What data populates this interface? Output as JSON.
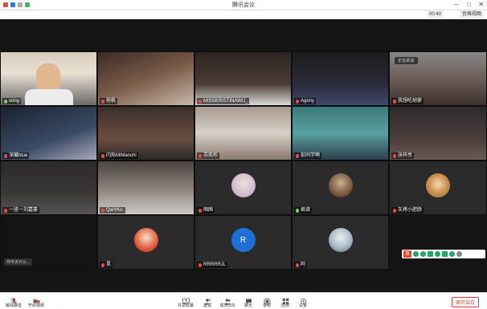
{
  "window": {
    "title": "腾讯会议"
  },
  "meeting": {
    "timer": "00:40",
    "view_mode": "宫格视图"
  },
  "participants": [
    {
      "name": "song",
      "mic": "on"
    },
    {
      "name": "杨帆",
      "mic": "off"
    },
    {
      "name": "MISSKRISTINAWU_",
      "mic": "off"
    },
    {
      "name": "Agony",
      "mic": "off"
    },
    {
      "name": "我想吃胡萝",
      "mic": "off"
    },
    {
      "name": "深藏blue",
      "mic": "off"
    },
    {
      "name": "闪烁MiManchi",
      "mic": "off"
    },
    {
      "name": "苏奕彤",
      "mic": "off"
    },
    {
      "name": "彭同学啊",
      "mic": "off"
    },
    {
      "name": "张梓亮",
      "mic": "off"
    },
    {
      "name": "一班一刘嘉豪",
      "mic": "off"
    },
    {
      "name": "QwYKo.",
      "mic": "off"
    },
    {
      "name": "囤囤",
      "mic": "off"
    },
    {
      "name": "君淑",
      "mic": "on"
    },
    {
      "name": "灰烤小肥肠",
      "mic": "off"
    },
    {
      "name": "昊",
      "mic": "off"
    },
    {
      "name": "RRRRRJL",
      "mic": "off",
      "avatar_letter": "R"
    },
    {
      "name": "阿",
      "mic": "off"
    }
  ],
  "chat_toast": "正在讲话:",
  "self_toast": "你今天什么...",
  "toolbar": {
    "unmute": "解除静音",
    "video": "开启视频",
    "share": "共享屏幕",
    "invite": "邀请",
    "members": "成员(19)",
    "chat": "聊天",
    "record": "录制",
    "apps": "应用",
    "settings": "设置",
    "end": "离开会议"
  },
  "ime": {
    "logo": "S"
  },
  "colors": {
    "accent": "#1f6fd8",
    "end": "#e53935",
    "speaker": "#f08a24"
  }
}
